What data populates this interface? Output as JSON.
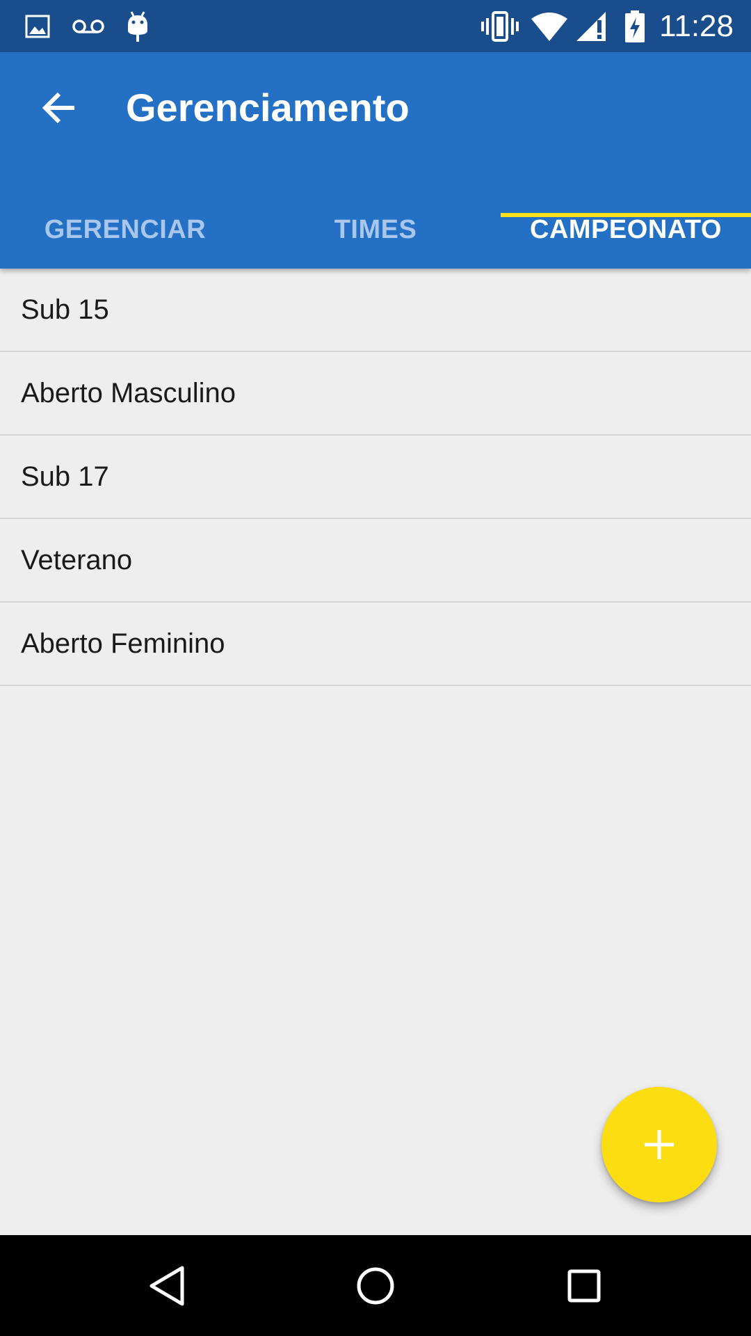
{
  "status_bar": {
    "time": "11:28",
    "left_icons": [
      "image-icon",
      "voicemail-icon",
      "android-debug-icon"
    ],
    "right_icons": [
      "vibrate-icon",
      "wifi-icon",
      "signal-icon",
      "battery-charging-icon"
    ]
  },
  "app_bar": {
    "title": "Gerenciamento",
    "back_icon": "arrow-left-icon",
    "color": "#2370c4"
  },
  "tabs": [
    {
      "label": "GERENCIAR",
      "active": false
    },
    {
      "label": "TIMES",
      "active": false
    },
    {
      "label": "CAMPEONATO",
      "active": true
    }
  ],
  "tab_indicator_color": "#fce01b",
  "list": {
    "items": [
      {
        "label": "Sub 15"
      },
      {
        "label": "Aberto Masculino"
      },
      {
        "label": "Sub 17"
      },
      {
        "label": "Veterano"
      },
      {
        "label": "Aberto Feminino"
      }
    ]
  },
  "fab": {
    "icon": "plus-icon",
    "color": "#fcdd12"
  },
  "nav_bar": {
    "icons": [
      "back-triangle-icon",
      "home-circle-icon",
      "recents-square-icon"
    ]
  }
}
